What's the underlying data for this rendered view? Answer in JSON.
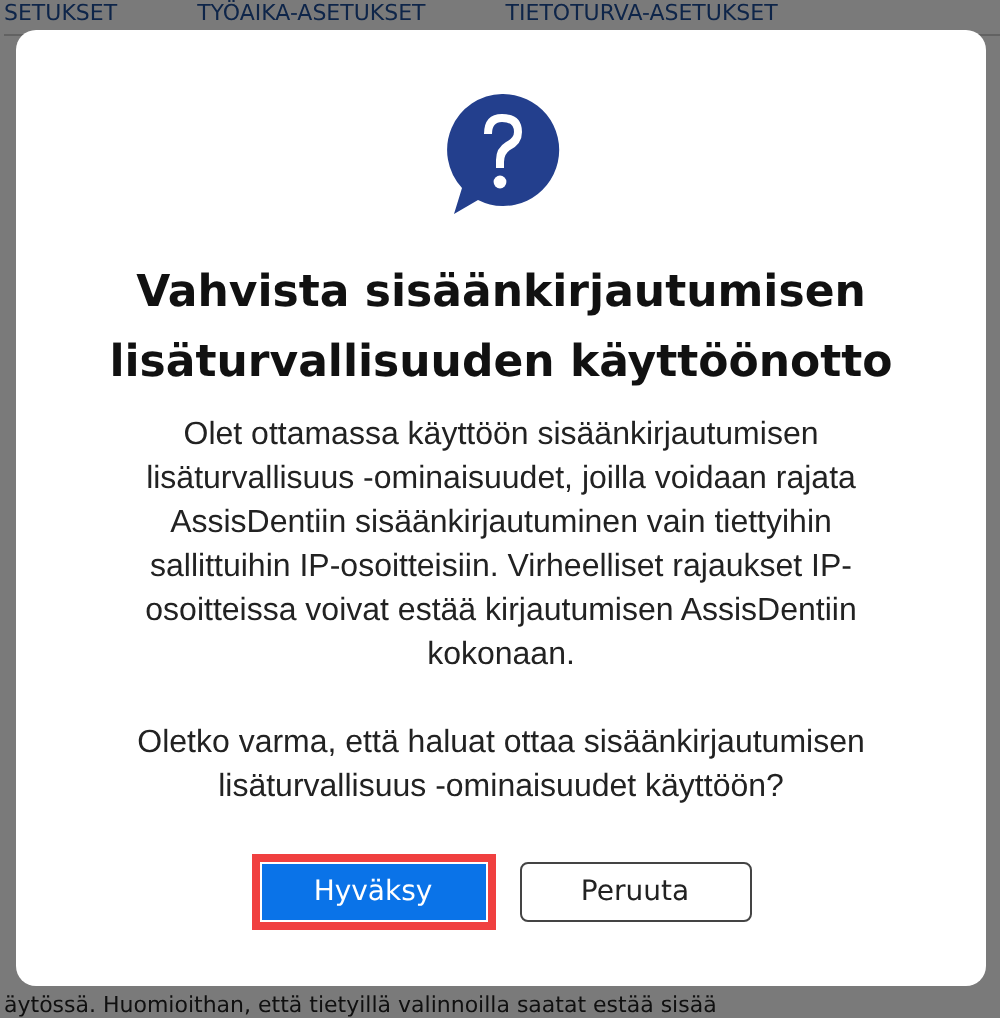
{
  "background": {
    "tabs": [
      "SETUKSET",
      "TYÖAIKA-ASETUKSET",
      "TIETOTURVA-ASETUKSET"
    ],
    "footer_text": "äytössä. Huomioithan, että tietyillä valinnoilla saatat estää sisää"
  },
  "dialog": {
    "title": "Vahvista sisäänkirjautumisen lisäturvallisuuden käyttöönotto",
    "paragraphs": [
      "Olet ottamassa käyttöön sisäänkirjautumisen lisäturvallisuus -ominaisuudet, joilla voidaan rajata AssisDentiin sisäänkirjautuminen vain tiettyihin sallittuihin IP-osoitteisiin. Virheelliset rajaukset IP-osoitteissa voivat estää kirjautumisen AssisDentiin kokonaan.",
      "Oletko varma, että haluat ottaa sisäänkirjautumisen lisäturvallisuus -ominaisuudet käyttöön?"
    ],
    "buttons": [
      {
        "label": "Hyväksy",
        "kind": "primary",
        "highlighted": true
      },
      {
        "label": "Peruuta",
        "kind": "secondary",
        "highlighted": false
      }
    ]
  }
}
